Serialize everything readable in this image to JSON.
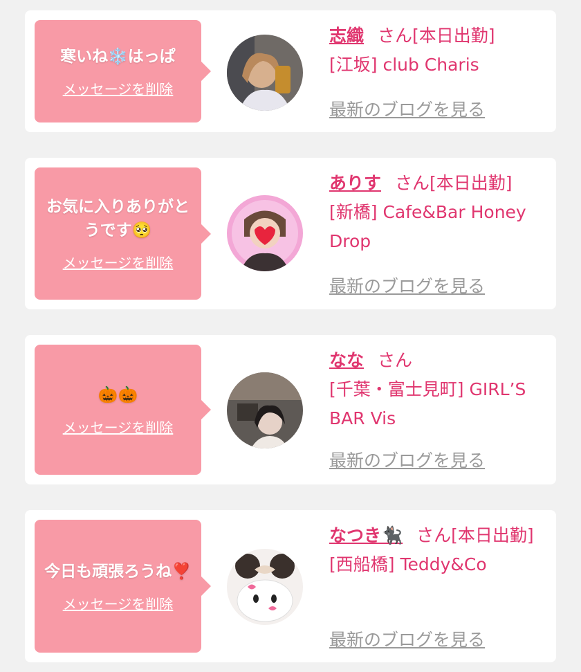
{
  "entries": [
    {
      "message": "寒いね❄️はっぱ",
      "delete_label": "メッセージを削除",
      "name": "志織",
      "honorific": "さん",
      "status": "[本日出勤]",
      "shop": "[江坂] club Charis",
      "blog_link": "最新のブログを見る"
    },
    {
      "message": "お気に入りありがとうです🥺",
      "delete_label": "メッセージを削除",
      "name": "ありす",
      "honorific": "さん",
      "status": "[本日出勤]",
      "shop": "[新橋] Cafe&Bar Honey Drop",
      "blog_link": "最新のブログを見る"
    },
    {
      "message": "🎃🎃",
      "delete_label": "メッセージを削除",
      "name": "なな",
      "honorific": "さん",
      "status": "",
      "shop": "[千葉・富士見町] GIRL’S BAR Vis",
      "blog_link": "最新のブログを見る"
    },
    {
      "message": "今日も頑張ろうね❣️",
      "delete_label": "メッセージを削除",
      "name": "なつき🐈‍⬛",
      "honorific": "さん",
      "status": "[本日出勤]",
      "shop": "[西船橋] Teddy&Co",
      "blog_link": "最新のブログを見る"
    }
  ]
}
